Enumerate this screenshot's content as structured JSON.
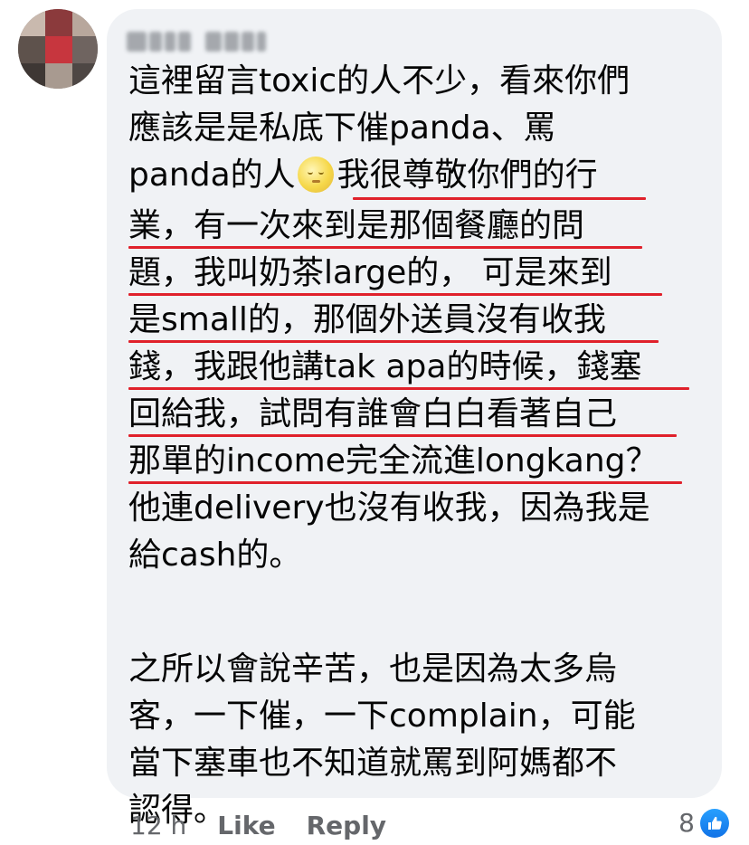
{
  "comment": {
    "lines": [
      "這裡留言toxic的人不少，看來你們",
      "應該是是私底下催panda、罵",
      "panda的人",
      "我很尊敬你們的行",
      "業，有一次來到是那個餐廳的問",
      "題，我叫奶茶large的， 可是來到",
      "是small的，那個外送員沒有收我",
      "錢，我跟他講tak apa的時候，錢塞",
      "回給我，試問有誰會白白看著自己",
      "那單的income完全流進longkang？",
      "他連delivery也沒有收我，因為我是",
      "給cash的。",
      "之所以會說辛苦，也是因為太多烏",
      "客，一下催，一下complain，可能",
      "當下塞車也不知道就罵到阿媽都不",
      "認得。"
    ],
    "emoji": "moon-face-icon",
    "underline_color": "#e0212b"
  },
  "footer": {
    "time": "12 h",
    "like_label": "Like",
    "reply_label": "Reply",
    "reaction_count": "8",
    "reaction_icon": "thumbs-up-icon"
  },
  "colors": {
    "bubble": "#f0f2f5",
    "text": "#050505",
    "meta": "#65676b",
    "like_blue": "#1877f2"
  }
}
